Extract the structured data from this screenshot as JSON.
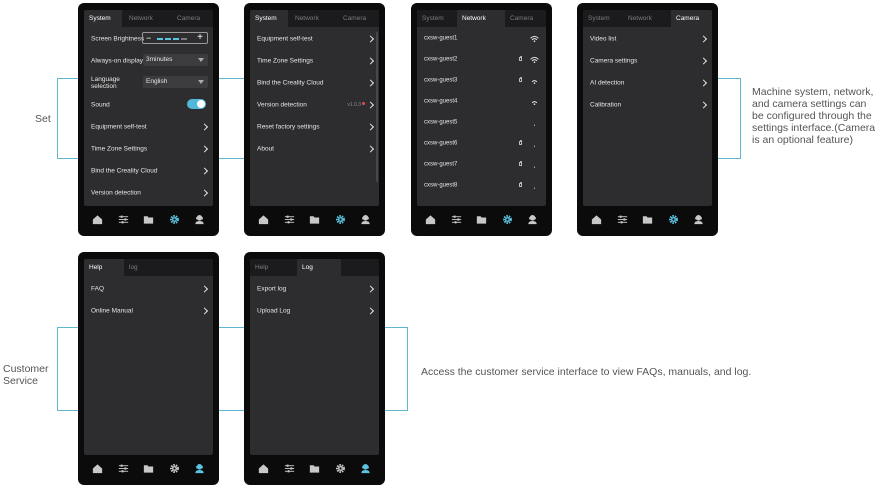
{
  "annotations": {
    "set": "Set",
    "customer_service": [
      "Customer",
      "Service"
    ],
    "settings_desc": [
      "Machine system, network,",
      "and camera settings can",
      "be configured through the",
      "settings interface.(Camera",
      "is an optional feature)"
    ],
    "service_desc": "Access the customer service interface to view FAQs, manuals, and log."
  },
  "colors": {
    "accent": "#5cc3e0",
    "connector": "#5fb8cf",
    "screen_bg": "#2d2d2f",
    "device_bg": "#0b0b0c",
    "badge": "#e24b4b"
  },
  "screen1": {
    "tabs": [
      "System",
      "Network",
      "Camera"
    ],
    "active_tab": "System",
    "rows": {
      "brightness": "Screen Brightness",
      "always_on": "Always-on display",
      "always_on_value": "3minutes",
      "language": [
        "Language",
        "selection"
      ],
      "language_value": "English",
      "sound": "Sound",
      "sound_on": true,
      "self_test": "Equipment self-test",
      "timezone": "Time Zone Settings",
      "bind": "Bind the Creality Cloud",
      "version": "Version detection"
    }
  },
  "screen2": {
    "tabs": [
      "System",
      "Network",
      "Camera"
    ],
    "active_tab": "System",
    "rows": [
      "Equipment self-test",
      "Time Zone Settings",
      "Bind the Creality Cloud",
      "Version detection",
      "Reset factory settings",
      "About"
    ],
    "version_value": "v1.0.3"
  },
  "screen3": {
    "tabs": [
      "System",
      "Network",
      "Camera"
    ],
    "active_tab": "Network",
    "networks": [
      {
        "name": "cxsw-guest1",
        "locked": false,
        "signal": "full"
      },
      {
        "name": "cxsw-guest2",
        "locked": true,
        "signal": "full"
      },
      {
        "name": "cxsw-guest3",
        "locked": true,
        "signal": "medium"
      },
      {
        "name": "cxsw-guest4",
        "locked": false,
        "signal": "medium"
      },
      {
        "name": "cxsw-guest5",
        "locked": false,
        "signal": "low"
      },
      {
        "name": "cxsw-guest6",
        "locked": true,
        "signal": "low"
      },
      {
        "name": "cxsw-guest7",
        "locked": true,
        "signal": "low"
      },
      {
        "name": "cxsw-guest8",
        "locked": true,
        "signal": "low"
      }
    ]
  },
  "screen4": {
    "tabs": [
      "System",
      "Network",
      "Camera"
    ],
    "active_tab": "Camera",
    "rows": [
      "Video list",
      "Camera settings",
      "AI detection",
      "Calibration"
    ]
  },
  "screen5": {
    "tabs": [
      "Help",
      "log"
    ],
    "active_tab": "Help",
    "rows": [
      "FAQ",
      "Online Manual"
    ]
  },
  "screen6": {
    "tabs": [
      "Help",
      "Log"
    ],
    "active_tab": "Log",
    "rows": [
      "Export log",
      "Upload Log"
    ]
  },
  "nav_icons": [
    "home-icon",
    "sliders-icon",
    "folder-icon",
    "gear-icon",
    "support-icon"
  ],
  "nav_active": {
    "settings_screens": "gear-icon",
    "service_screens": "support-icon"
  }
}
